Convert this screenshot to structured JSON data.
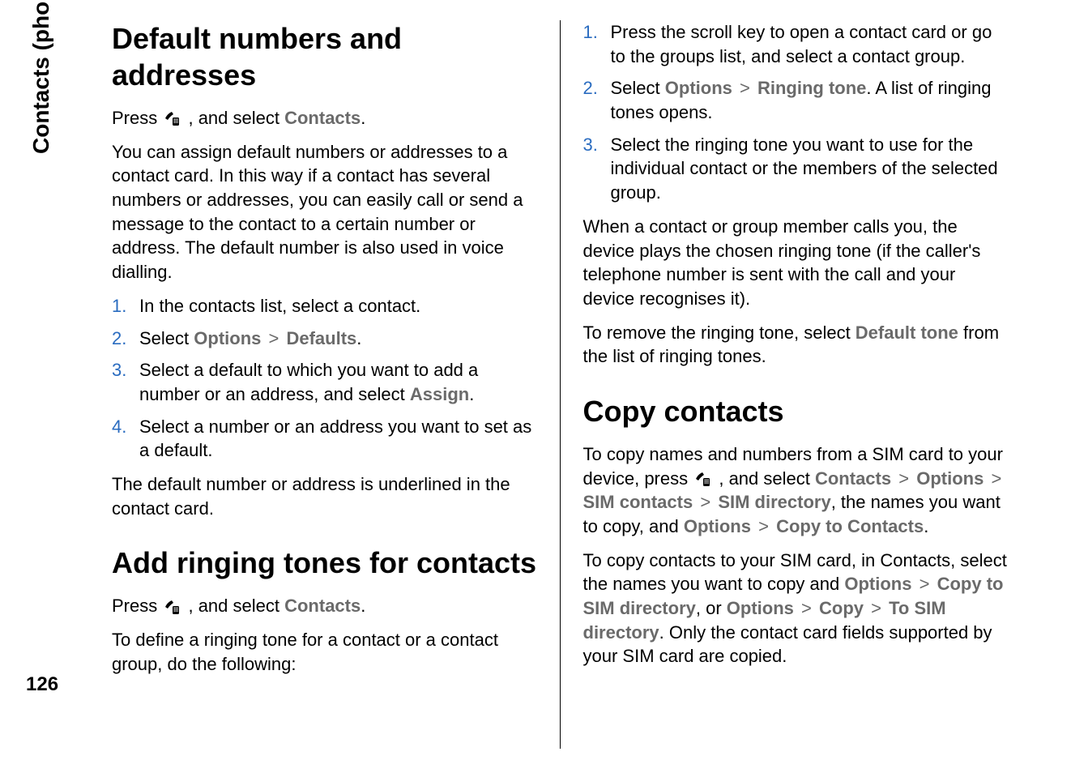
{
  "side_label": "Contacts (phonebook)",
  "page_number": "126",
  "gt": ">",
  "ui": {
    "contacts": "Contacts",
    "options": "Options",
    "defaults": "Defaults",
    "assign": "Assign",
    "ringing_tone": "Ringing tone",
    "default_tone": "Default tone",
    "sim_contacts": "SIM contacts",
    "sim_directory": "SIM directory",
    "copy_to_contacts": "Copy to Contacts",
    "copy_to_sim_directory": "Copy to SIM directory",
    "copy": "Copy",
    "to_sim_directory": "To SIM directory"
  },
  "left": {
    "h1a": "Default numbers and addresses",
    "p1a": "Press ",
    "p1b": " , and select ",
    "p1c": ".",
    "p2": "You can assign default numbers or addresses to a contact card. In this way if a contact has several numbers or addresses, you can easily call or send a message to the contact to a certain number or address. The default number is also used in voice dialling.",
    "li1": "In the contacts list, select a contact.",
    "li2a": "Select ",
    "li2b": ".",
    "li3a": "Select a default to which you want to add a number or an address, and select ",
    "li3b": ".",
    "li4": "Select a number or an address you want to set as a default.",
    "p3": "The default number or address is underlined in the contact card.",
    "h1b": "Add ringing tones for contacts",
    "p4a": "Press ",
    "p4b": " , and select ",
    "p4c": ".",
    "p5": "To define a ringing tone for a contact or a contact group, do the following:"
  },
  "right": {
    "li1": "Press the scroll key to open a contact card or go to the groups list, and select a contact group.",
    "li2a": "Select ",
    "li2b": ". A list of ringing tones opens.",
    "li3": "Select the ringing tone you want to use for the individual contact or the members of the selected group.",
    "p1": "When a contact or group member calls you, the device plays the chosen ringing tone (if the caller's telephone number is sent with the call and your device recognises it).",
    "p2a": "To remove the ringing tone, select ",
    "p2b": " from the list of ringing tones.",
    "h1": "Copy contacts",
    "p3a": "To copy names and numbers from a SIM card to your device, press ",
    "p3b": " , and select ",
    "p3c": ", the names you want to copy, and ",
    "p3d": ".",
    "p4a": "To copy contacts to your SIM card, in Contacts, select the names you want to copy and ",
    "p4b": ", or ",
    "p4c": ". Only the contact card fields supported by your SIM card are copied."
  },
  "nums": {
    "1": "1.",
    "2": "2.",
    "3": "3.",
    "4": "4."
  }
}
